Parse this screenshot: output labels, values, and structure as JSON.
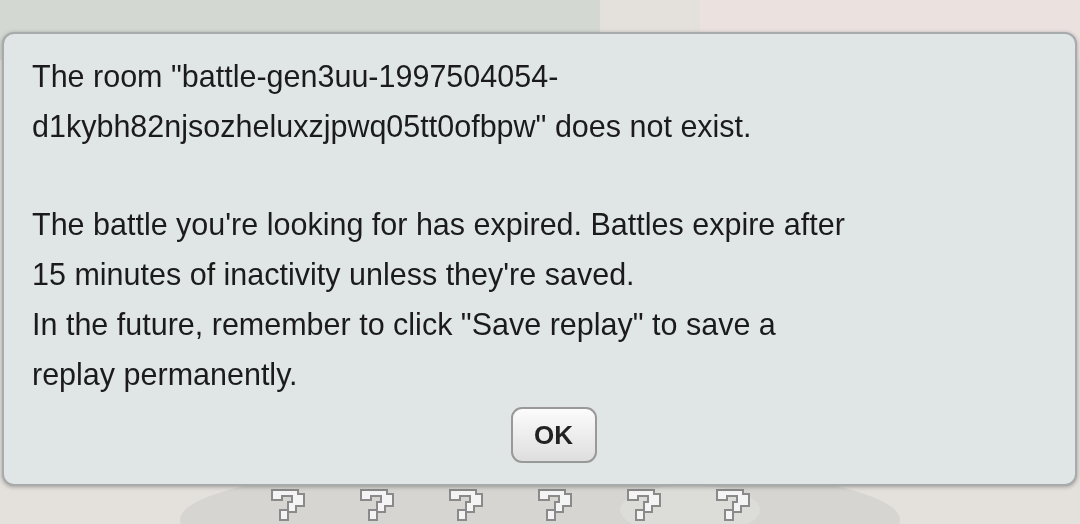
{
  "dialog": {
    "paragraphs": [
      [
        "The room \"battle-gen3uu-1997504054-",
        "d1kybh82njsozheluxzjpwq05tt0ofbpw\" does not exist."
      ],
      [
        "The battle you're looking for has expired. Battles expire after",
        "15 minutes of inactivity unless they're saved.",
        "In the future, remember to click \"Save replay\" to save a",
        "replay permanently."
      ]
    ],
    "button": "OK"
  }
}
